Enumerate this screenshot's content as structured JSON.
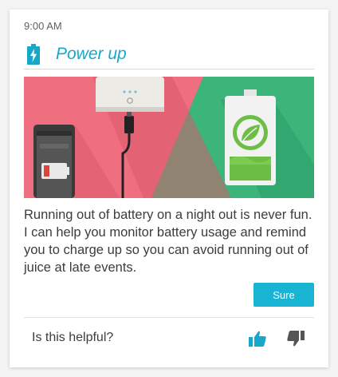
{
  "card": {
    "time": "9:00 AM",
    "title": "Power up",
    "icon": "battery-charging-icon",
    "hero_image": "phone-charger-battery-illustration",
    "body": "Running out of battery on a night out is never fun. I can help you monitor battery usage and remind you to charge up so you can avoid running out of juice at late events.",
    "action_label": "Sure",
    "feedback_prompt": "Is this helpful?",
    "feedback_icons": [
      "thumbs-up-icon",
      "thumbs-down-icon"
    ]
  },
  "colors": {
    "accent": "#17a8c9",
    "button": "#19b3d4",
    "hero_left": "#ef6e7f",
    "hero_right": "#3bb57a"
  }
}
